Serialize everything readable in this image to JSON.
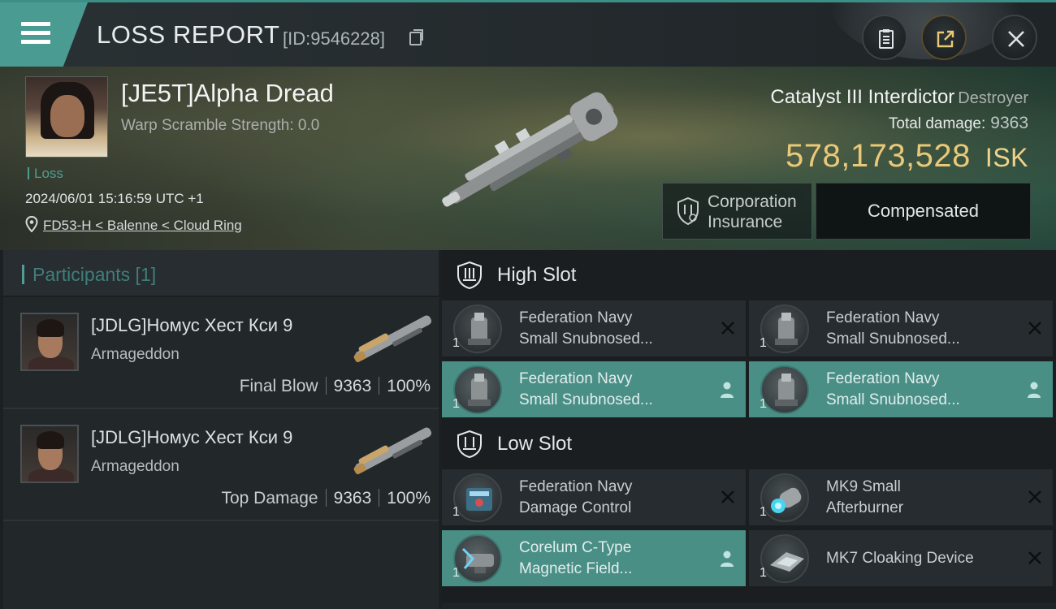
{
  "header": {
    "title": "LOSS REPORT",
    "id_text": "[ID:9546228]",
    "icons": [
      "menu-icon",
      "copy-icon",
      "clipboard-icon",
      "share-icon",
      "close-icon"
    ]
  },
  "victim": {
    "name": "[JE5T]Alpha Dread",
    "warp_scramble": "Warp Scramble Strength: 0.0",
    "loss_label": "Loss",
    "datetime": "2024/06/01 15:16:59 UTC +1",
    "location": "FD53-H < Balenne < Cloud Ring"
  },
  "ship": {
    "name": "Catalyst III Interdictor",
    "class": "Destroyer",
    "total_damage_label": "Total damage:",
    "total_damage": "9363",
    "isk_value": "578,173,528",
    "isk_unit": "ISK",
    "insurance_label_line1": "Corporation",
    "insurance_label_line2": "Insurance",
    "compensated_label": "Compensated"
  },
  "participants": {
    "header": "Participants [1]",
    "list": [
      {
        "name": "[JDLG]Номус Хест Кси 9",
        "ship": "Armageddon",
        "role": "Final Blow",
        "damage": "9363",
        "percent": "100%"
      },
      {
        "name": "[JDLG]Номус Хест Кси 9",
        "ship": "Armageddon",
        "role": "Top Damage",
        "damage": "9363",
        "percent": "100%"
      }
    ]
  },
  "fitting": {
    "high_slot_label": "High Slot",
    "low_slot_label": "Low Slot",
    "high": [
      {
        "line1": "Federation Navy",
        "line2": "Small Snubnosed...",
        "qty": "1",
        "state": "destroyed"
      },
      {
        "line1": "Federation Navy",
        "line2": "Small Snubnosed...",
        "qty": "1",
        "state": "destroyed"
      },
      {
        "line1": "Federation Navy",
        "line2": "Small Snubnosed...",
        "qty": "1",
        "state": "dropped"
      },
      {
        "line1": "Federation Navy",
        "line2": "Small Snubnosed...",
        "qty": "1",
        "state": "dropped"
      }
    ],
    "low": [
      {
        "line1": "Federation Navy",
        "line2": "Damage Control",
        "qty": "1",
        "state": "destroyed"
      },
      {
        "line1": "MK9 Small",
        "line2": "Afterburner",
        "qty": "1",
        "state": "destroyed"
      },
      {
        "line1": "Corelum C-Type",
        "line2": "Magnetic Field...",
        "qty": "1",
        "state": "dropped"
      },
      {
        "line1": "MK7 Cloaking Device",
        "line2": "",
        "qty": "1",
        "state": "destroyed"
      }
    ]
  },
  "colors": {
    "accent": "#4a9c92",
    "isk_gold": "#e9c877",
    "dropped_bg": "#4a8f86"
  }
}
